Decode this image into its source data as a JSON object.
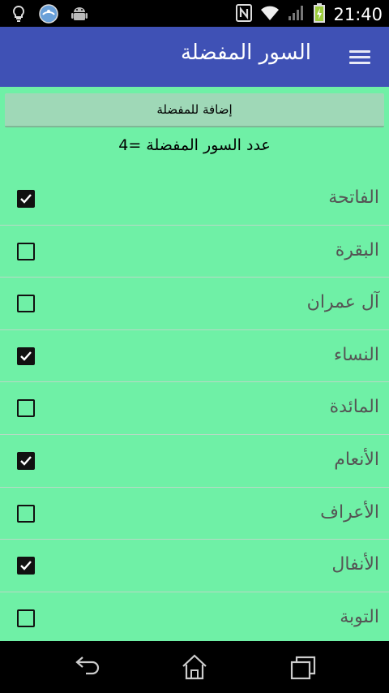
{
  "status_bar": {
    "time": "21:40",
    "icons": [
      "bulb-icon",
      "quran-app-icon",
      "android-icon",
      "nfc-icon",
      "wifi-icon",
      "signal-icon",
      "battery-charging-icon"
    ]
  },
  "app_bar": {
    "title": "السور المفضلة",
    "menu_icon": "hamburger-menu-icon",
    "color": "#3f51b5"
  },
  "add_button": {
    "label": "إضافة للمفضلة"
  },
  "favorites_count": {
    "label": "عدد السور المفضلة =4"
  },
  "surahs": [
    {
      "name": "الفاتحة",
      "checked": true
    },
    {
      "name": "البقرة",
      "checked": false
    },
    {
      "name": "آل عمران",
      "checked": false
    },
    {
      "name": "النساء",
      "checked": true
    },
    {
      "name": "المائدة",
      "checked": false
    },
    {
      "name": "الأنعام",
      "checked": true
    },
    {
      "name": "الأعراف",
      "checked": false
    },
    {
      "name": "الأنفال",
      "checked": true
    },
    {
      "name": "التوبة",
      "checked": false
    }
  ],
  "nav_bar": {
    "icons": [
      "back-icon",
      "home-icon",
      "recent-apps-icon"
    ]
  },
  "colors": {
    "background": "#6ff0a6",
    "app_bar": "#3f51b5",
    "button": "#9fd8b7"
  }
}
